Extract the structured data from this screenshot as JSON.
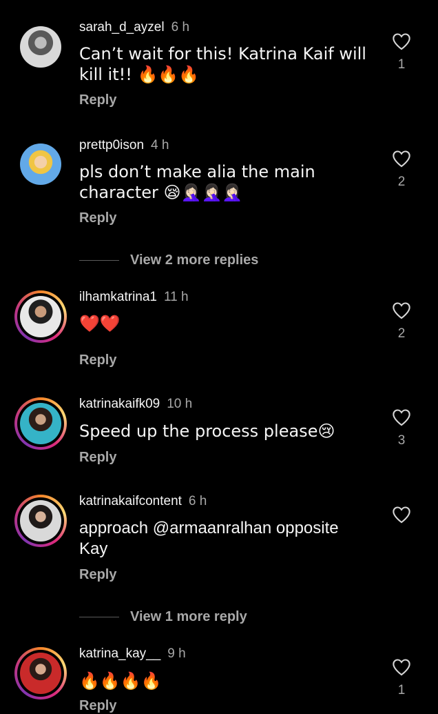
{
  "comments": [
    {
      "username": "sarah_d_ayzel",
      "time": "6 h",
      "text": "Can’t wait for this! Katrina Kaif will kill it!! 🔥🔥🔥",
      "reply_label": "Reply",
      "likes": "1",
      "has_story_ring": false
    },
    {
      "username": "prettp0ison",
      "time": "4 h",
      "text": "pls don’t make alia the main character 😪🤦🏻‍♀️🤦🏻‍♀️🤦🏻‍♀️",
      "reply_label": "Reply",
      "likes": "2",
      "has_story_ring": false
    },
    {
      "username": "ilhamkatrina1",
      "time": "11 h",
      "text": "❤️❤️",
      "reply_label": "Reply",
      "likes": "2",
      "has_story_ring": true
    },
    {
      "username": "katrinakaifk09",
      "time": "10 h",
      "text": "Speed up the process please😢",
      "reply_label": "Reply",
      "likes": "3",
      "has_story_ring": true
    },
    {
      "username": "katrinakaifcontent",
      "time": "6 h",
      "text": "approach @armaanralhan opposite Kay",
      "reply_label": "Reply",
      "likes": "",
      "has_story_ring": true
    },
    {
      "username": "katrina_kay__",
      "time": "9 h",
      "text": "🔥🔥🔥🔥",
      "reply_label": "Reply",
      "likes": "1",
      "has_story_ring": true
    }
  ],
  "view_more": [
    {
      "label": "View 2 more replies"
    },
    {
      "label": "View 1 more reply"
    }
  ],
  "icons": {
    "like": "heart-outline-icon"
  },
  "colors": {
    "background": "#000000",
    "primary_text": "#f5f5f5",
    "secondary_text": "#a8a8a8"
  }
}
